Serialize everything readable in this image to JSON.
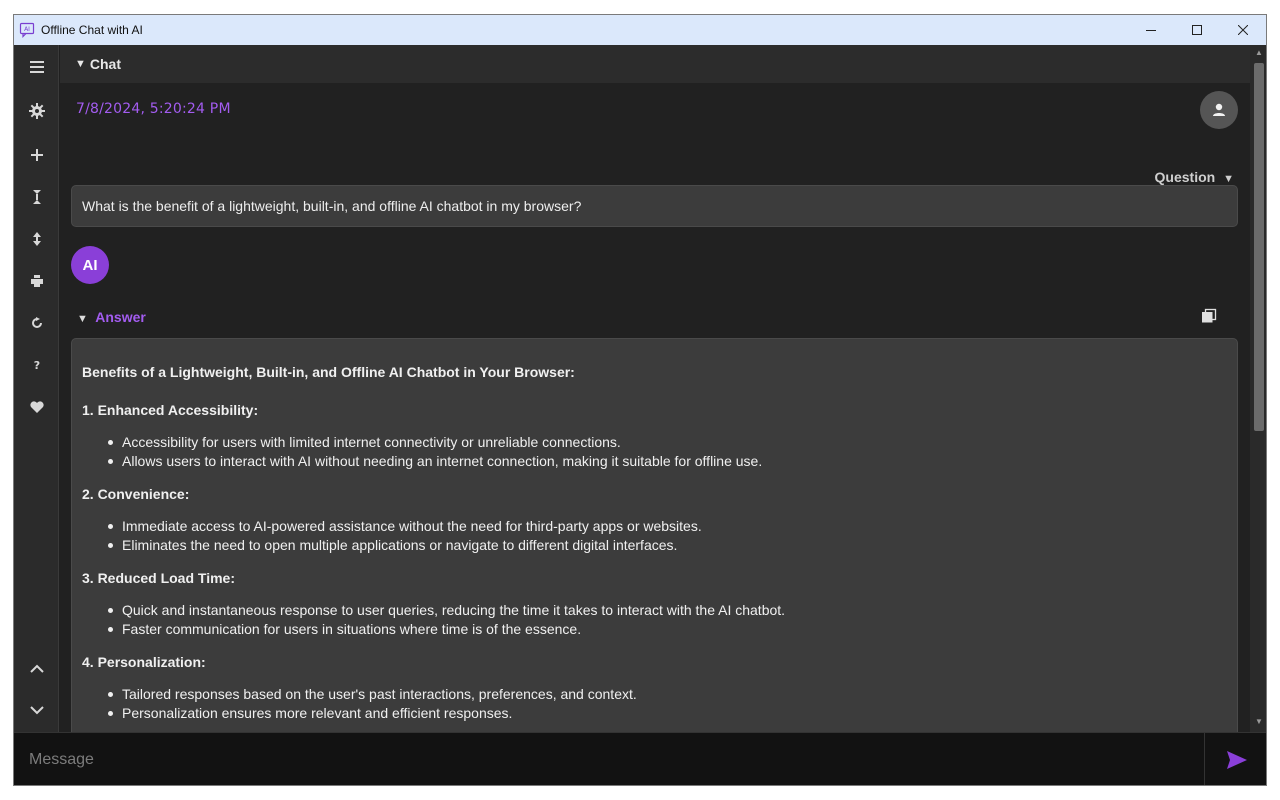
{
  "window": {
    "title": "Offline Chat with AI"
  },
  "sidebar": {
    "items": [
      {
        "name": "menu-icon"
      },
      {
        "name": "gear-icon"
      },
      {
        "name": "plus-icon"
      },
      {
        "name": "collapse-all-icon"
      },
      {
        "name": "expand-all-icon"
      },
      {
        "name": "print-icon"
      },
      {
        "name": "refresh-icon"
      },
      {
        "name": "help-icon"
      },
      {
        "name": "heart-icon"
      },
      {
        "name": "chevron-up-icon"
      },
      {
        "name": "chevron-down-icon"
      }
    ]
  },
  "chat": {
    "header": "Chat",
    "timestamp": "7/8/2024, 5:20:24 PM",
    "question_toggle": "Question",
    "question": "What is the benefit of a lightweight, built-in, and offline AI chatbot in my browser?",
    "ai_avatar": "AI",
    "answer_toggle": "Answer",
    "answer": {
      "title": "Benefits of a Lightweight, Built-in, and Offline AI Chatbot in Your Browser:",
      "sections": [
        {
          "heading": "1. Enhanced Accessibility:",
          "bullets": [
            "Accessibility for users with limited internet connectivity or unreliable connections.",
            "Allows users to interact with AI without needing an internet connection, making it suitable for offline use."
          ]
        },
        {
          "heading": "2. Convenience:",
          "bullets": [
            "Immediate access to AI-powered assistance without the need for third-party apps or websites.",
            "Eliminates the need to open multiple applications or navigate to different digital interfaces."
          ]
        },
        {
          "heading": "3. Reduced Load Time:",
          "bullets": [
            "Quick and instantaneous response to user queries, reducing the time it takes to interact with the AI chatbot.",
            "Faster communication for users in situations where time is of the essence."
          ]
        },
        {
          "heading": "4. Personalization:",
          "bullets": [
            "Tailored responses based on the user's past interactions, preferences, and context.",
            "Personalization ensures more relevant and efficient responses."
          ]
        }
      ]
    }
  },
  "composer": {
    "placeholder": "Message"
  },
  "colors": {
    "accent": "#a35cf0",
    "ai_avatar_bg": "#8a3fd8",
    "titlebar_bg": "#dbe8fb"
  }
}
